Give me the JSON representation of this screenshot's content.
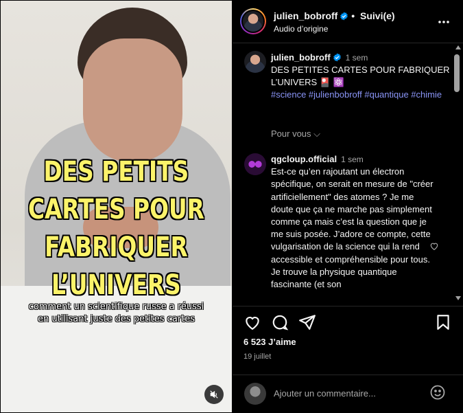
{
  "video": {
    "title_lines": [
      "DES PETITS",
      "CARTES POUR",
      "FABRIQUER",
      "L’UNIVERS"
    ],
    "subtitle_lines": [
      "comment un scientifique russe a réussi",
      "en utilisant juste des petites cartes"
    ],
    "mute_icon": "muted-speaker-icon"
  },
  "header": {
    "username": "julien_bobroff",
    "separator": "•",
    "follow_status": "Suivi(e)",
    "audio": "Audio d’origine"
  },
  "post_caption": {
    "username": "julien_bobroff",
    "time": "1 sem",
    "text": "DES PETITES CARTES POUR FABRIQUER L’UNIVERS 🎴 ⚛️",
    "hashtags": "#science #julienbobroff #quantique #chimie",
    "for_you": "Pour vous ⌵"
  },
  "comment": {
    "username": "qgcloup.official",
    "time": "1 sem",
    "text": "Est-ce qu’en rajoutant un électron spécifique, on serait en mesure de \"créer artificiellement\" des atomes ? Je me doute que ça ne marche pas simplement comme ça mais c’est la question que je me suis posée. J’adore ce compte, cette vulgarisation de la science qui la rend accessible et compréhensible pour tous. Je trouve la physique quantique fascinante (et son"
  },
  "actions": {
    "likes": "6 523 J’aime",
    "date": "19 juillet"
  },
  "add_comment": {
    "placeholder": "Ajouter un commentaire..."
  },
  "colors": {
    "background": "#000000",
    "hashtag": "#8a95f7",
    "verified": "#0095f6",
    "overlay_title": "#fbf36a",
    "secondary_text": "#a8a8a8"
  }
}
